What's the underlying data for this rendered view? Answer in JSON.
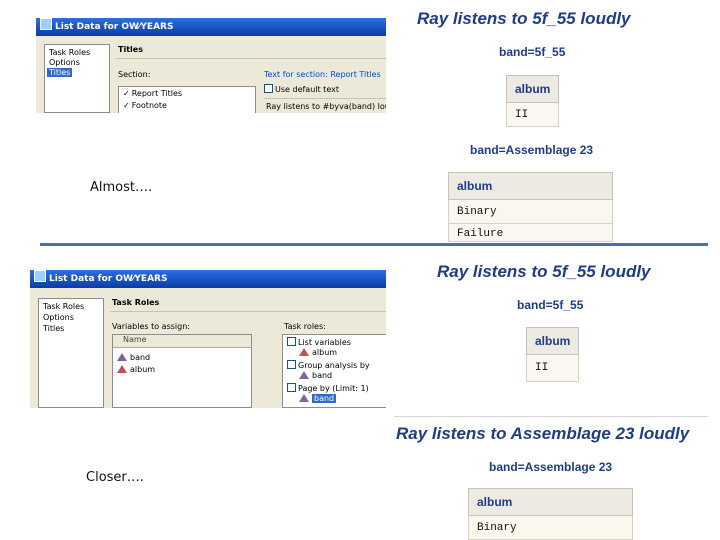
{
  "top": {
    "dialog": {
      "title": "List Data for OW⁄YEARS",
      "nav": [
        "Task Roles",
        "Options",
        "Titles"
      ],
      "nav_selected": 2,
      "section_heading": "Titles",
      "section_label": "Section:",
      "text_for_label": "Text for section: Report Titles",
      "sections": [
        "Report Titles",
        "Footnote"
      ],
      "use_default_label": "Use default text",
      "text_value": "Ray listens to #byva(band) loudly"
    },
    "report": {
      "title": "Ray listens to 5f_55 loudly",
      "groups": [
        {
          "heading": "band=5f_55",
          "column": "album",
          "rows": [
            "II"
          ]
        },
        {
          "heading": "band=Assemblage 23",
          "column": "album",
          "rows": [
            "Binary",
            "Failure"
          ]
        }
      ]
    },
    "caption": "Almost…."
  },
  "bottom": {
    "dialog": {
      "title": "List Data for OW⁄YEARS",
      "nav": [
        "Task Roles",
        "Options",
        "Titles"
      ],
      "section_heading": "Task Roles",
      "vars_label": "Variables to assign:",
      "vars_header": "Name",
      "vars": [
        "band",
        "album"
      ],
      "roles_label": "Task roles:",
      "roles": [
        {
          "label": "List variables",
          "child": "album"
        },
        {
          "label": "Group analysis by",
          "child": "band"
        },
        {
          "label": "Page by (Limit: 1)",
          "child": "band"
        }
      ]
    },
    "report1": {
      "title": "Ray listens to 5f_55 loudly",
      "heading": "band=5f_55",
      "column": "album",
      "rows": [
        "II"
      ]
    },
    "report2": {
      "title": "Ray listens to Assemblage 23 loudly",
      "heading": "band=Assemblage 23",
      "column": "album",
      "rows": [
        "Binary"
      ]
    },
    "caption": "Closer…."
  }
}
